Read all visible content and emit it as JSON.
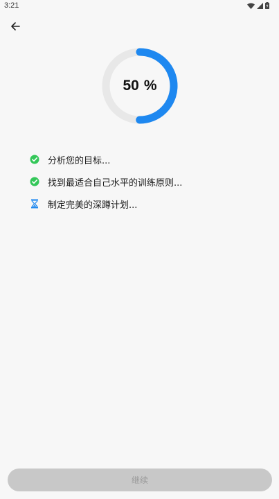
{
  "status_bar": {
    "time": "3:21",
    "icons": [
      "wifi-icon",
      "signal-icon",
      "battery-icon"
    ]
  },
  "header": {
    "back_icon": "arrow-left-icon"
  },
  "progress": {
    "value": 50,
    "value_text": "50",
    "unit": "%",
    "track_color": "#e8e8e8",
    "fill_color": "#1e88f0"
  },
  "steps": [
    {
      "label": "分析您的目标...",
      "status": "done",
      "icon": "check-circle-icon",
      "color": "#34c759"
    },
    {
      "label": "找到最适合自己水平的训练原则...",
      "status": "done",
      "icon": "check-circle-icon",
      "color": "#34c759"
    },
    {
      "label": "制定完美的深蹲计划...",
      "status": "in-progress",
      "icon": "hourglass-icon",
      "color": "#1e88f0"
    }
  ],
  "footer": {
    "continue_label": "继续",
    "continue_enabled": false
  }
}
